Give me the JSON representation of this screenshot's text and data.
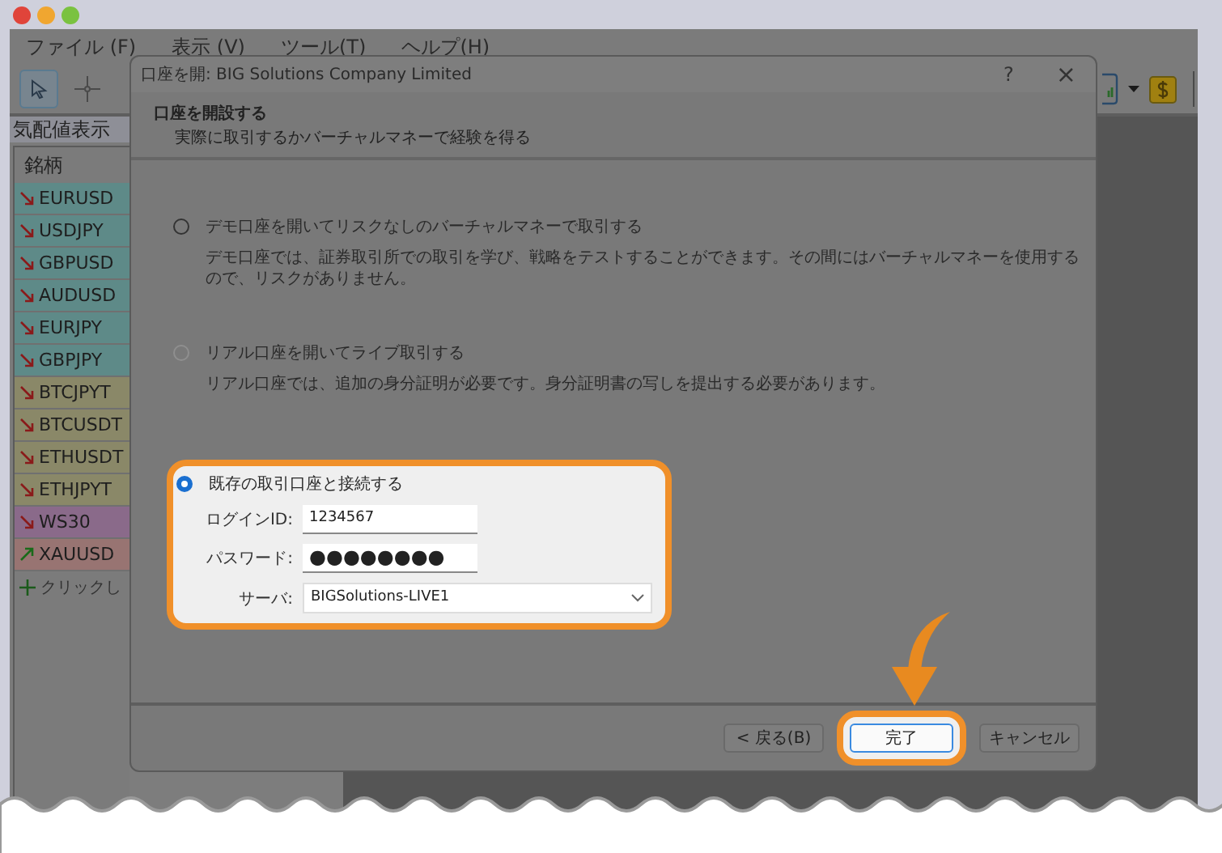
{
  "menu": [
    {
      "label": "ファイル (F)"
    },
    {
      "label": "表示 (V)"
    },
    {
      "label": "ツール(T)"
    },
    {
      "label": "ヘルプ(H)"
    }
  ],
  "market_watch": {
    "title": "気配値表示",
    "column": "銘柄",
    "rows": [
      {
        "symbol": "EURUSD",
        "kind": "down",
        "color": "#5e8a88"
      },
      {
        "symbol": "USDJPY",
        "kind": "down",
        "color": "#5e8a88"
      },
      {
        "symbol": "GBPUSD",
        "kind": "down",
        "color": "#5e8a88"
      },
      {
        "symbol": "AUDUSD",
        "kind": "down",
        "color": "#5e8a88"
      },
      {
        "symbol": "EURJPY",
        "kind": "down",
        "color": "#5e8a88"
      },
      {
        "symbol": "GBPJPY",
        "kind": "down",
        "color": "#5e8a88"
      },
      {
        "symbol": "BTCJPYT",
        "kind": "down",
        "color": "#8a8868"
      },
      {
        "symbol": "BTCUSDT",
        "kind": "down",
        "color": "#8a8868"
      },
      {
        "symbol": "ETHUSDT",
        "kind": "down",
        "color": "#8a8868"
      },
      {
        "symbol": "ETHJPYT",
        "kind": "down",
        "color": "#8a8868"
      },
      {
        "symbol": "WS30",
        "kind": "down",
        "color": "#8a6a8a"
      },
      {
        "symbol": "XAUUSD",
        "kind": "up",
        "color": "#987472"
      }
    ],
    "add_row": "クリックし"
  },
  "dialog": {
    "title": "口座を開: BIG Solutions Company Limited",
    "help": "?",
    "close": "×",
    "heading": "口座を開設する",
    "subheading": "実際に取引するかバーチャルマネーで経験を得る",
    "options": [
      {
        "kind": "choice",
        "label": "デモ口座を開いてリスクなしのバーチャルマネーで取引する",
        "description": "デモ口座では、証券取引所での取引を学び、戦略をテストすることができます。その間にはバーチャルマネーを使用するので、リスクがありません。",
        "selected": false,
        "disabled": false,
        "highlighted": false
      },
      {
        "kind": "choice",
        "label": "リアル口座を開いてライブ取引する",
        "description": "リアル口座では、追加の身分証明が必要です。身分証明書の写しを提出する必要があります。",
        "selected": false,
        "disabled": true,
        "highlighted": false
      },
      {
        "kind": "login",
        "label": "既存の取引口座と接続する",
        "selected": true,
        "disabled": false,
        "highlighted": true,
        "fields": [
          {
            "kind": "text",
            "label": "ログインID:",
            "value": "1234567"
          },
          {
            "kind": "password",
            "label": "パスワード:",
            "value": "●●●●●●●●"
          },
          {
            "kind": "select",
            "label": "サーバ:",
            "value": "BIGSolutions-LIVE1"
          }
        ]
      }
    ],
    "buttons": [
      {
        "label": "< 戻る(B)",
        "default": false,
        "highlighted": false
      },
      {
        "label": "完了",
        "default": true,
        "highlighted": true
      },
      {
        "label": "キャンセル",
        "default": false,
        "highlighted": false
      }
    ]
  }
}
